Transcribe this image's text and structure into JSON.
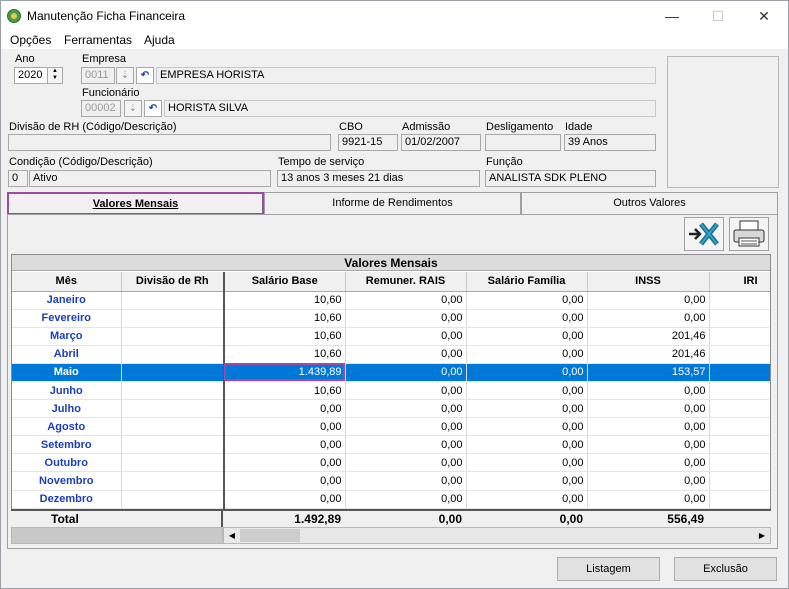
{
  "window": {
    "title": "Manutenção Ficha Financeira",
    "minimize": "—",
    "maximize": "☐",
    "close": "✕"
  },
  "menu": [
    "Opções",
    "Ferramentas",
    "Ajuda"
  ],
  "form": {
    "ano_label": "Ano",
    "ano_value": "2020",
    "empresa_label": "Empresa",
    "empresa_code": "0011",
    "empresa_name": "EMPRESA HORISTA",
    "funcionario_label": "Funcionário",
    "funcionario_code": "00002",
    "funcionario_name": "HORISTA SILVA",
    "divisao_label": "Divisão de RH (Código/Descrição)",
    "divisao_value": "",
    "cbo_label": "CBO",
    "cbo_value": "9921-15",
    "admissao_label": "Admissão",
    "admissao_value": "01/02/2007",
    "desligamento_label": "Desligamento",
    "desligamento_value": "",
    "idade_label": "Idade",
    "idade_value": "39 Anos",
    "condicao_label": "Condição (Código/Descrição)",
    "condicao_code": "0",
    "condicao_desc": "Ativo",
    "tempo_label": "Tempo de serviço",
    "tempo_value": "13 anos 3 meses 21 dias",
    "funcao_label": "Função",
    "funcao_value": "ANALISTA SDK PLENO"
  },
  "tabs": [
    "Valores Mensais",
    "Informe de Rendimentos",
    "Outros Valores"
  ],
  "grid": {
    "title": "Valores Mensais",
    "columns": [
      "Mês",
      "Divisão de Rh",
      "Salário Base",
      "Remuner. RAIS",
      "Salário Família",
      "INSS",
      "IRI"
    ],
    "rows": [
      [
        "Janeiro",
        "",
        "10,60",
        "0,00",
        "0,00",
        "0,00"
      ],
      [
        "Fevereiro",
        "",
        "10,60",
        "0,00",
        "0,00",
        "0,00"
      ],
      [
        "Março",
        "",
        "10,60",
        "0,00",
        "0,00",
        "201,46"
      ],
      [
        "Abril",
        "",
        "10,60",
        "0,00",
        "0,00",
        "201,46"
      ],
      [
        "Maio",
        "",
        "1.439,89",
        "0,00",
        "0,00",
        "153,57"
      ],
      [
        "Junho",
        "",
        "10,60",
        "0,00",
        "0,00",
        "0,00"
      ],
      [
        "Julho",
        "",
        "0,00",
        "0,00",
        "0,00",
        "0,00"
      ],
      [
        "Agosto",
        "",
        "0,00",
        "0,00",
        "0,00",
        "0,00"
      ],
      [
        "Setembro",
        "",
        "0,00",
        "0,00",
        "0,00",
        "0,00"
      ],
      [
        "Outubro",
        "",
        "0,00",
        "0,00",
        "0,00",
        "0,00"
      ],
      [
        "Novembro",
        "",
        "0,00",
        "0,00",
        "0,00",
        "0,00"
      ],
      [
        "Dezembro",
        "",
        "0,00",
        "0,00",
        "0,00",
        "0,00"
      ]
    ],
    "selected_row": 4,
    "total_label": "Total",
    "totals": [
      "1.492,89",
      "0,00",
      "0,00",
      "556,49"
    ]
  },
  "buttons": {
    "listagem": "Listagem",
    "exclusao": "Exclusão"
  },
  "icons": {
    "export": "excel-export-icon",
    "print": "printer-icon"
  }
}
